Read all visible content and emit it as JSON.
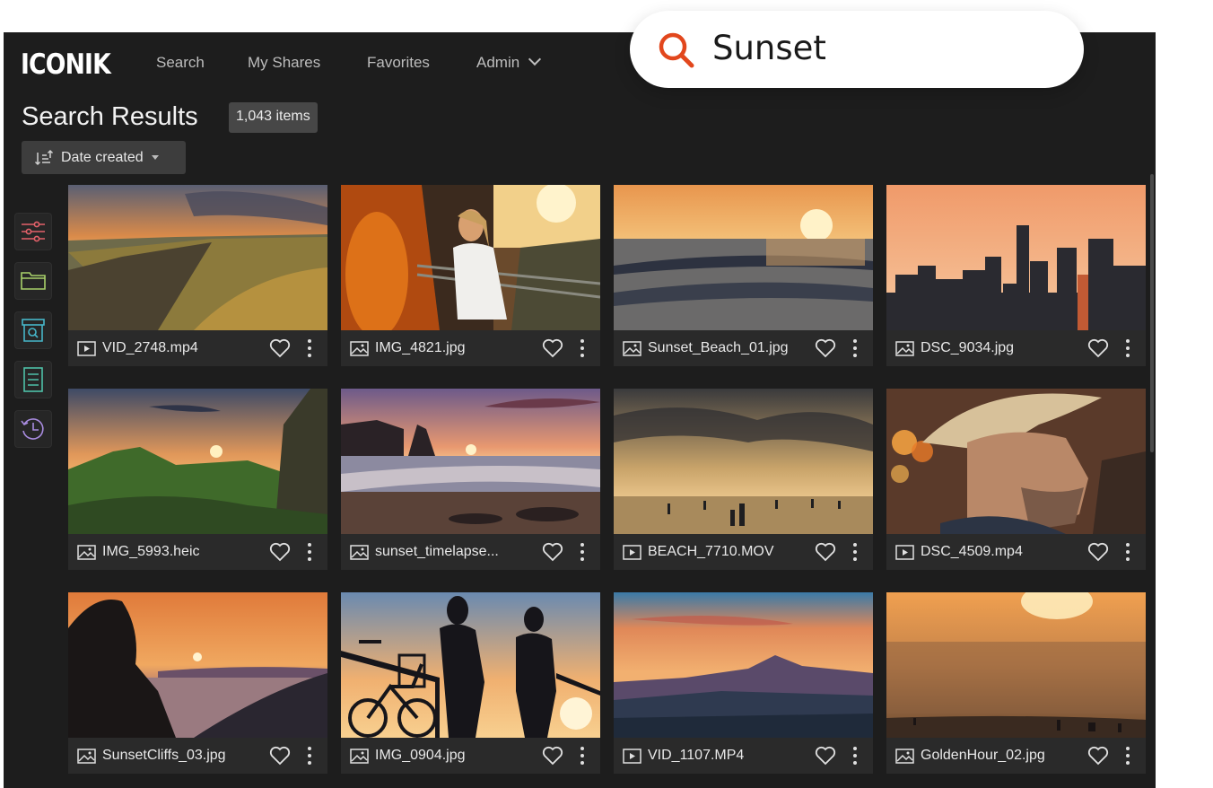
{
  "app": {
    "logo": "ICONIK"
  },
  "nav": {
    "items": [
      "Search",
      "My Shares",
      "Favorites",
      "Admin"
    ]
  },
  "search": {
    "query": "Sunset"
  },
  "results": {
    "title": "Search Results",
    "count": "1,043 items",
    "sort_label": "Date created"
  },
  "sidebar": {
    "icons": [
      "filters-icon",
      "folder-icon",
      "archive-search-icon",
      "document-icon",
      "history-icon"
    ]
  },
  "colors": {
    "accent": "#e2471d",
    "background": "#1d1d1d",
    "card": "#2a2a2a"
  },
  "assets": [
    {
      "name": "VID_2748.mp4",
      "type": "video"
    },
    {
      "name": "IMG_4821.jpg",
      "type": "image"
    },
    {
      "name": "Sunset_Beach_01.jpg",
      "type": "image"
    },
    {
      "name": "DSC_9034.jpg",
      "type": "image"
    },
    {
      "name": "IMG_5993.heic",
      "type": "image"
    },
    {
      "name": "sunset_timelapse...",
      "type": "image"
    },
    {
      "name": "BEACH_7710.MOV",
      "type": "video"
    },
    {
      "name": "DSC_4509.mp4",
      "type": "video"
    },
    {
      "name": "SunsetCliffs_03.jpg",
      "type": "image"
    },
    {
      "name": "IMG_0904.jpg",
      "type": "image"
    },
    {
      "name": "VID_1107.MP4",
      "type": "video"
    },
    {
      "name": "GoldenHour_02.jpg",
      "type": "image"
    }
  ]
}
